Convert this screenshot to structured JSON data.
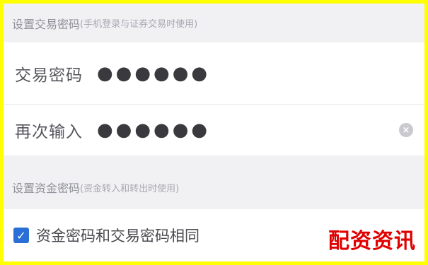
{
  "section_trade": {
    "title": "设置交易密码",
    "note": "(手机登录与证券交易时使用)"
  },
  "trade_password": {
    "label": "交易密码",
    "value": "●●●●●●"
  },
  "confirm_password": {
    "label": "再次输入",
    "value": "●●●●●●"
  },
  "section_fund": {
    "title": "设置资金密码",
    "note": "(资金转入和转出时使用)"
  },
  "same_password_checkbox": {
    "label": "资金密码和交易密码相同",
    "checked": true
  },
  "watermark": "配资资讯",
  "colors": {
    "accent": "#2a6fd6",
    "watermark": "#e00000",
    "frame": "#ffff00"
  }
}
